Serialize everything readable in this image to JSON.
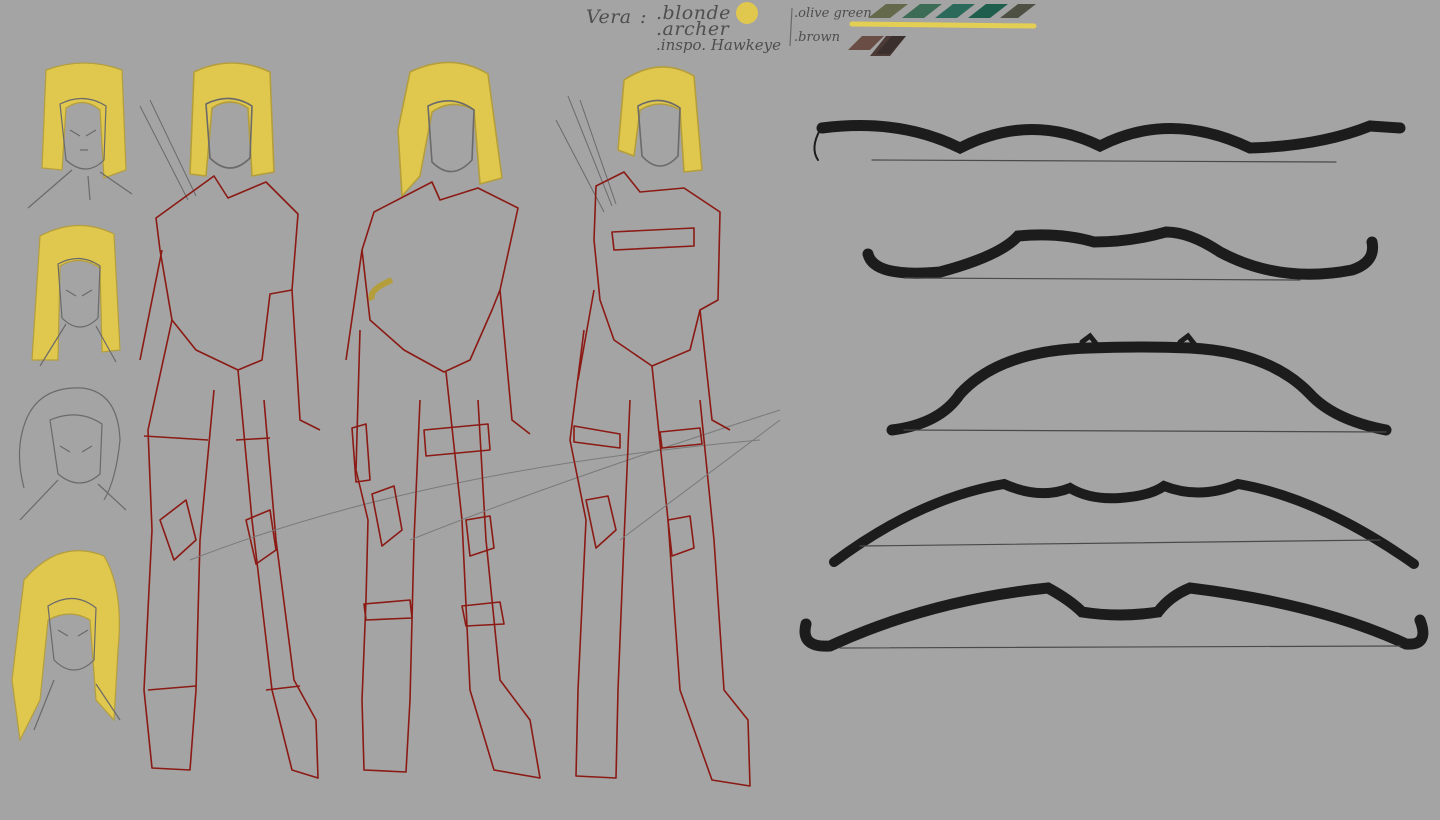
{
  "character": {
    "name": "Vera",
    "separator": ":",
    "traits": [
      ".blonde",
      ".archer",
      ".inspo. Hawkeye"
    ],
    "hair_color": "#e0c74e"
  },
  "palette": {
    "olive_label": ".olive green",
    "brown_label": ".brown",
    "olive_swatches": [
      "#65694c",
      "#3c6b56",
      "#2b6a5a",
      "#1d5e4c",
      "#4e5043"
    ],
    "brown_swatches": [
      "#6a4e45",
      "#4b3a35",
      "#3a2f2c"
    ],
    "highlight": "#e4cf55"
  },
  "colors": {
    "background": "#a4a4a4",
    "sketch_line": "#6a6a6a",
    "armor_line": "#8b1a14",
    "bow_ink": "#1c1c1c"
  }
}
